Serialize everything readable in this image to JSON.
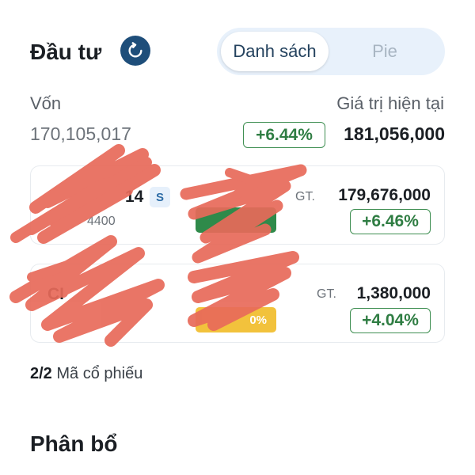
{
  "header": {
    "title": "Đầu tư",
    "refresh_icon": "refresh-icon",
    "tabs": [
      {
        "label": "Danh sách",
        "active": true
      },
      {
        "label": "Pie",
        "active": false
      }
    ]
  },
  "summary": {
    "capital_label": "Vốn",
    "capital_amount": "170,105,017",
    "value_label": "Giá trị hiện tại",
    "change_pct": "+6.44%",
    "current_value": "181,056,000"
  },
  "holdings": [
    {
      "ticker_partial": "14",
      "tag": "S",
      "sub_partial": "4400",
      "gt_label": "GT.",
      "value": "179,676,000",
      "change": "+6.46%",
      "bar_color": "#2f8a4a"
    },
    {
      "ticker_partial": "CI",
      "gt_label": "GT.",
      "value": "1,380,000",
      "change": "+4.04%",
      "bar_label": "0%",
      "bar_color": "#f2c23c"
    }
  ],
  "footer": {
    "count": "2/2",
    "count_label": "Mã cổ phiếu",
    "section_title": "Phân bổ"
  },
  "colors": {
    "accent_dark": "#1e4e7a",
    "positive": "#2f7d43",
    "toggle_bg": "#e8f1fb",
    "redaction": "#e86a5a"
  }
}
